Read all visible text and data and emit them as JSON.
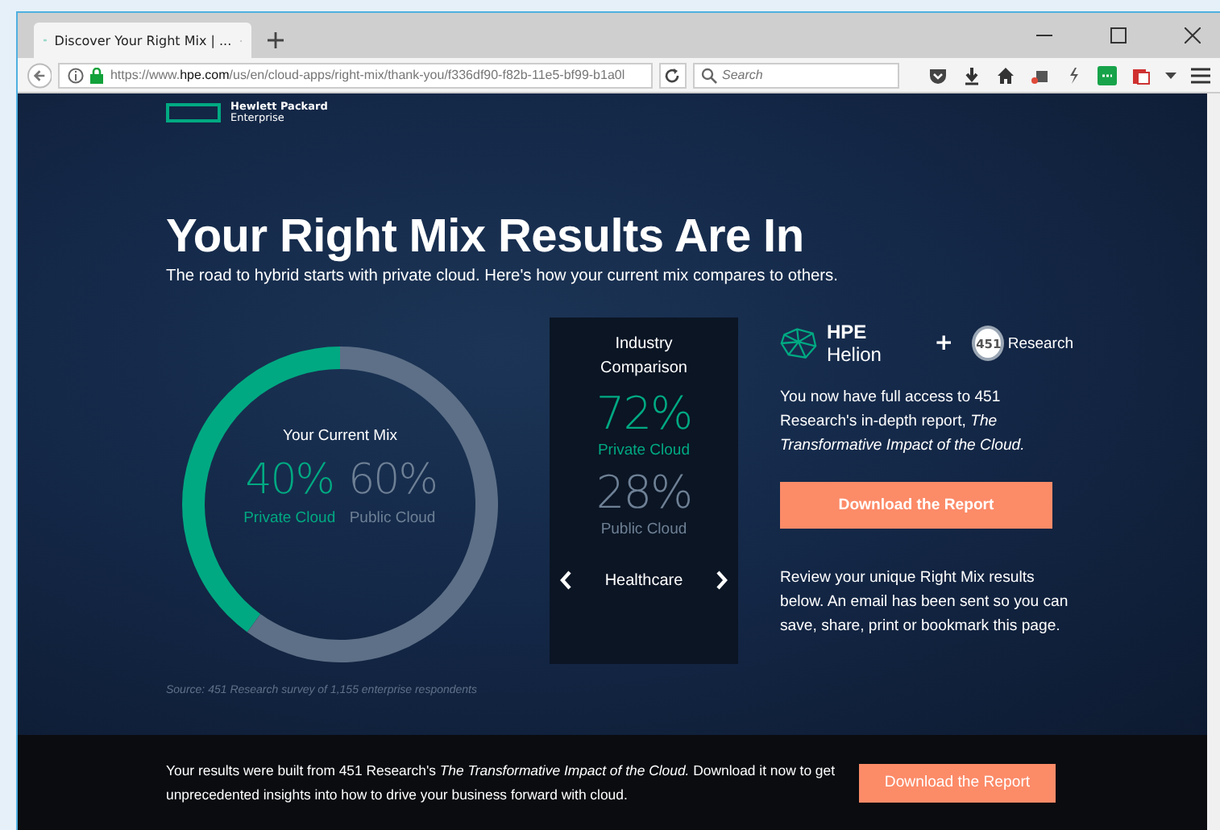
{
  "browser": {
    "tab": {
      "title": "Discover Your Right Mix | ...",
      "selected": true
    },
    "url": "https://www.**hpe.com**/us/en/cloud-apps/right-mix/thank-you/f336df90-f82b-11e5-bf99-b1a0l",
    "search": {
      "placeholder": "Search"
    }
  },
  "page": {
    "logo": {
      "line1": "Hewlett Packard",
      "line2": "Enterprise"
    },
    "title": "Your Right Mix Results Are In",
    "subtitle": "The road to hybrid starts with private cloud. Here's how your current mix compares to others.",
    "current_mix": {
      "chart_data": {
        "type": "donut",
        "title": "Your Current Mix",
        "categories": [
          "Private Cloud",
          "Public Cloud"
        ],
        "values": [
          40,
          60
        ],
        "value_labels": [
          "40%",
          "60%"
        ]
      }
    },
    "source": "Source: 451 Research survey of 1,155 enterprise respondents",
    "industry": {
      "heading": "Industry Comparison",
      "stats": [
        {
          "value": "72%",
          "label": "Private Cloud",
          "kind": "private"
        },
        {
          "value": "28%",
          "label": "Public Cloud",
          "kind": "public"
        }
      ],
      "sector": "Healthcare"
    },
    "partners": {
      "helion": "**HPE** Helion",
      "plus": "+",
      "badge": "451",
      "research": "Research"
    },
    "access_text": "You now have full access to 451 Research's in-depth report, *The Transformative Impact of the Cloud.*",
    "download": "Download the Report",
    "review_text": "Review your unique Right Mix results below. An email has been sent so you can save, share, print or bookmark this page.",
    "footer": {
      "text": "Your results were built from 451 Research's *The Transformative Impact of the Cloud.* Download it now to get unprecedented insights into how to drive your business forward with cloud.",
      "button": "Download the Report"
    }
  }
}
